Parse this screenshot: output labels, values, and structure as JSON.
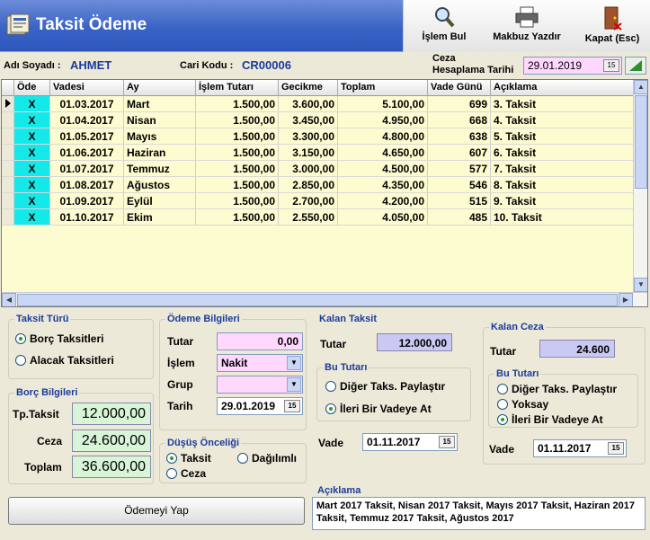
{
  "header": {
    "title": "Taksit Ödeme"
  },
  "toolbar": {
    "search_label": "İşlem Bul",
    "print_label": "Makbuz Yazdır",
    "close_label": "Kapat (Esc)"
  },
  "customer": {
    "name_label": "Adı Soyadı :",
    "name_value": "AHMET",
    "code_label": "Cari Kodu :",
    "code_value": "CR00006",
    "penalty_date_label_1": "Ceza",
    "penalty_date_label_2": "Hesaplama Tarihi",
    "penalty_date_value": "29.01.2019"
  },
  "grid": {
    "columns": [
      "Öde",
      "Vadesi",
      "Ay",
      "İşlem Tutarı",
      "Gecikme",
      "Toplam",
      "Vade Günü",
      "Açıklama"
    ],
    "rows": [
      {
        "pay": "X",
        "due": "01.03.2017",
        "month": "Mart",
        "amount": "1.500,00",
        "delay": "3.600,00",
        "total": "5.100,00",
        "days": "699",
        "desc": "3. Taksit"
      },
      {
        "pay": "X",
        "due": "01.04.2017",
        "month": "Nisan",
        "amount": "1.500,00",
        "delay": "3.450,00",
        "total": "4.950,00",
        "days": "668",
        "desc": "4. Taksit"
      },
      {
        "pay": "X",
        "due": "01.05.2017",
        "month": "Mayıs",
        "amount": "1.500,00",
        "delay": "3.300,00",
        "total": "4.800,00",
        "days": "638",
        "desc": "5. Taksit"
      },
      {
        "pay": "X",
        "due": "01.06.2017",
        "month": "Haziran",
        "amount": "1.500,00",
        "delay": "3.150,00",
        "total": "4.650,00",
        "days": "607",
        "desc": "6. Taksit"
      },
      {
        "pay": "X",
        "due": "01.07.2017",
        "month": "Temmuz",
        "amount": "1.500,00",
        "delay": "3.000,00",
        "total": "4.500,00",
        "days": "577",
        "desc": "7. Taksit"
      },
      {
        "pay": "X",
        "due": "01.08.2017",
        "month": "Ağustos",
        "amount": "1.500,00",
        "delay": "2.850,00",
        "total": "4.350,00",
        "days": "546",
        "desc": "8. Taksit"
      },
      {
        "pay": "X",
        "due": "01.09.2017",
        "month": "Eylül",
        "amount": "1.500,00",
        "delay": "2.700,00",
        "total": "4.200,00",
        "days": "515",
        "desc": "9. Taksit"
      },
      {
        "pay": "X",
        "due": "01.10.2017",
        "month": "Ekim",
        "amount": "1.500,00",
        "delay": "2.550,00",
        "total": "4.050,00",
        "days": "485",
        "desc": "10. Taksit"
      }
    ]
  },
  "installment_type": {
    "title": "Taksit Türü",
    "debt_label": "Borç Taksitleri",
    "credit_label": "Alacak Taksitleri"
  },
  "debt_info": {
    "title": "Borç Bilgileri",
    "installment_label": "Tp.Taksit",
    "installment_value": "12.000,00",
    "penalty_label": "Ceza",
    "penalty_value": "24.600,00",
    "total_label": "Toplam",
    "total_value": "36.600,00"
  },
  "payment_info": {
    "title": "Ödeme Bilgileri",
    "amount_label": "Tutar",
    "amount_value": "0,00",
    "transaction_label": "İşlem",
    "transaction_value": "Nakit",
    "group_label": "Grup",
    "group_value": "",
    "date_label": "Tarih",
    "date_value": "29.01.2019"
  },
  "priority": {
    "title": "Düşüş Önceliği",
    "installment_label": "Taksit",
    "distributed_label": "Dağılımlı",
    "penalty_label": "Ceza"
  },
  "remaining_installment": {
    "title": "Kalan Taksit",
    "amount_label": "Tutar",
    "amount_value": "12.000,00",
    "sub_title": "Bu Tutarı",
    "share_label": "Diğer Taks. Paylaştır",
    "forward_label": "İleri Bir Vadeye At",
    "due_label": "Vade",
    "due_value": "01.11.2017"
  },
  "remaining_penalty": {
    "title": "Kalan Ceza",
    "amount_label": "Tutar",
    "amount_value": "24.600",
    "sub_title": "Bu Tutarı",
    "share_label": "Diğer Taks. Paylaştır",
    "ignore_label": "Yoksay",
    "forward_label": "İleri Bir Vadeye At",
    "due_label": "Vade",
    "due_value": "01.11.2017"
  },
  "pay_button_label": "Ödemeyi Yap",
  "description": {
    "title": "Açıklama",
    "text": "Mart 2017 Taksit, Nisan 2017 Taksit, Mayıs 2017 Taksit, Haziran 2017 Taksit, Temmuz 2017 Taksit, Ağustos 2017"
  }
}
